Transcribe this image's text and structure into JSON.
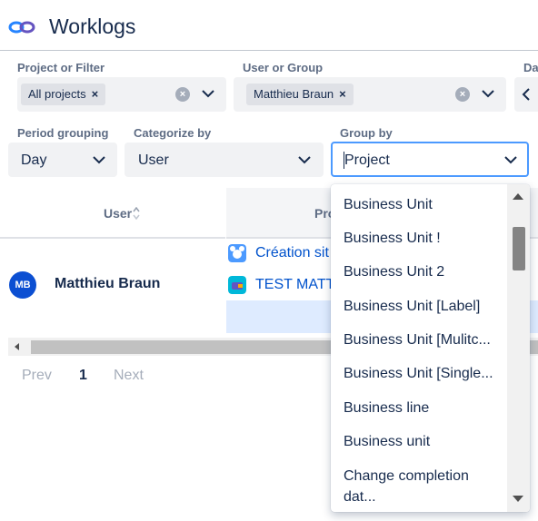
{
  "header": {
    "title": "Worklogs",
    "logo_icon": "infinity-loop-icon"
  },
  "filters": {
    "project": {
      "label": "Project or Filter",
      "chip": "All projects",
      "chip_remove": "×"
    },
    "user": {
      "label": "User or Group",
      "chip": "Matthieu Braun",
      "chip_remove": "×"
    },
    "date": {
      "label": "Da"
    },
    "period": {
      "label": "Period grouping",
      "value": "Day"
    },
    "categorize": {
      "label": "Categorize by",
      "value": "User"
    },
    "groupby": {
      "label": "Group by",
      "value": "Project"
    }
  },
  "table": {
    "columns": {
      "user": "User",
      "project": "Pro"
    },
    "rows": [
      {
        "avatar_initials": "MB",
        "user": "Matthieu Braun",
        "projects": [
          "Création sit",
          "TEST MATT"
        ]
      }
    ]
  },
  "pagination": {
    "prev": "Prev",
    "current": "1",
    "next": "Next"
  },
  "dropdown": {
    "items": [
      "Business Unit",
      "Business Unit !",
      "Business Unit 2",
      "Business Unit [Label]",
      "Business Unit [Mulitc...",
      "Business Unit [Single...",
      "Business line",
      "Business unit",
      "Change completion",
      "dat..."
    ]
  },
  "colors": {
    "accent": "#0052cc",
    "avatar": "#0c4fd2",
    "focus_border": "#4c9aff",
    "highlight_row": "#deebff"
  }
}
